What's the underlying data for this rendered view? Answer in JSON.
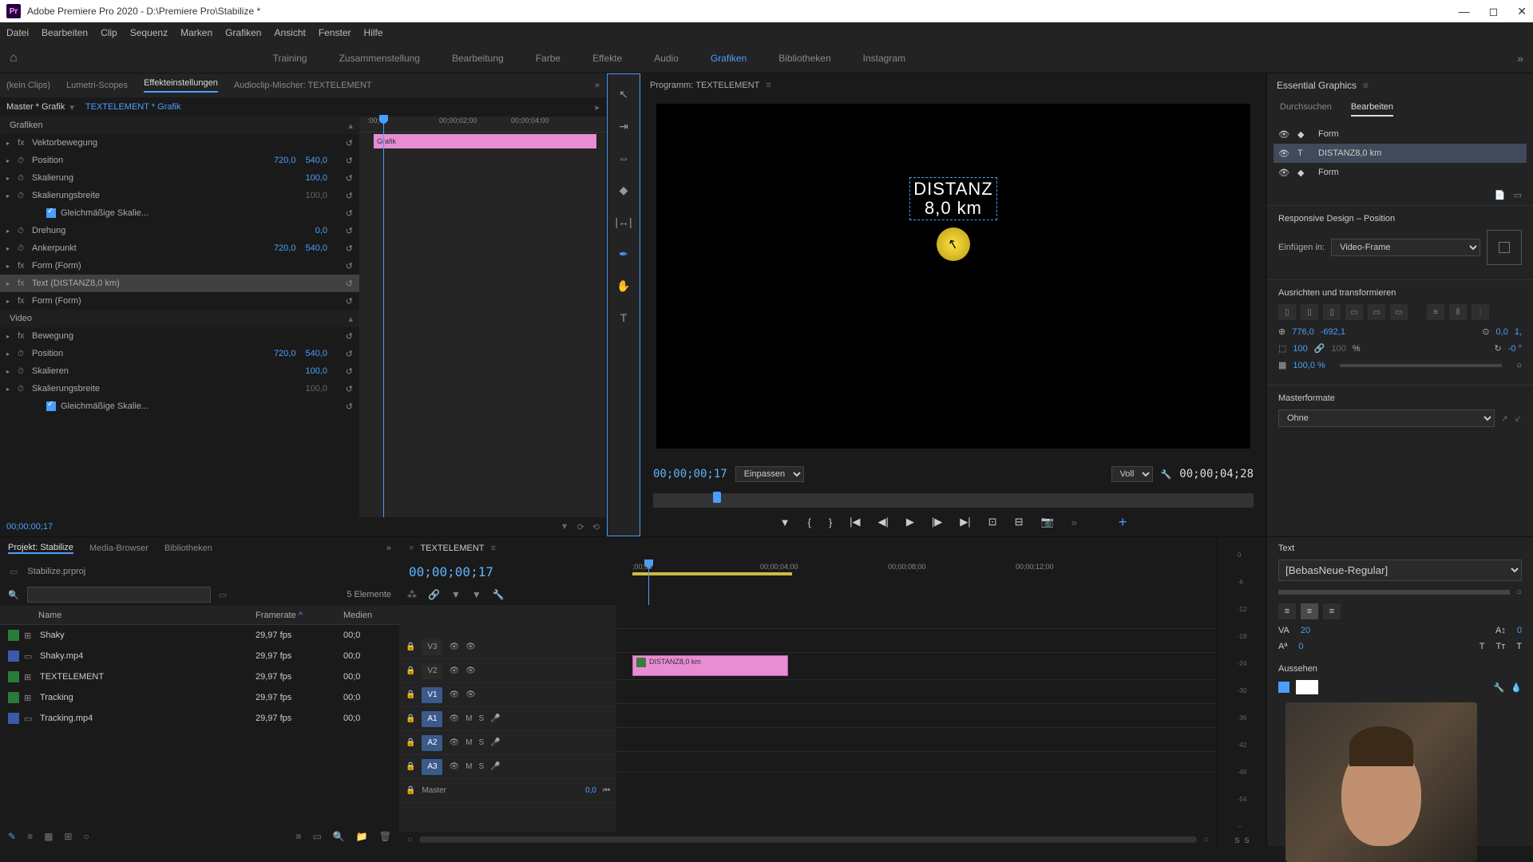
{
  "titlebar": {
    "app_badge": "Pr",
    "title": "Adobe Premiere Pro 2020 - D:\\Premiere Pro\\Stabilize *"
  },
  "menubar": [
    "Datei",
    "Bearbeiten",
    "Clip",
    "Sequenz",
    "Marken",
    "Grafiken",
    "Ansicht",
    "Fenster",
    "Hilfe"
  ],
  "workspaces": {
    "items": [
      "Training",
      "Zusammenstellung",
      "Bearbeitung",
      "Farbe",
      "Effekte",
      "Audio",
      "Grafiken",
      "Bibliotheken",
      "Instagram"
    ],
    "active": "Grafiken"
  },
  "effect_panel": {
    "tabs": [
      "(kein Clips)",
      "Lumetri-Scopes",
      "Effekteinstellungen",
      "Audioclip-Mischer: TEXTELEMENT"
    ],
    "active_tab": "Effekteinstellungen",
    "master": "Master * Grafik",
    "clip": "TEXTELEMENT * Grafik",
    "ruler": [
      ":00;00",
      "00;00;02;00",
      "00;00;04;00"
    ],
    "kf_clip_label": "Grafik",
    "groups": [
      {
        "label": "Grafiken",
        "type": "header"
      },
      {
        "label": "Vektorbewegung",
        "type": "fx"
      },
      {
        "label": "Position",
        "type": "prop",
        "val1": "720,0",
        "val2": "540,0"
      },
      {
        "label": "Skalierung",
        "type": "prop",
        "val1": "100,0"
      },
      {
        "label": "Skalierungsbreite",
        "type": "prop_gray",
        "val1": "100,0"
      },
      {
        "label": "Gleichmäßige Skalie...",
        "type": "check"
      },
      {
        "label": "Drehung",
        "type": "prop",
        "val1": "0,0"
      },
      {
        "label": "Ankerpunkt",
        "type": "prop",
        "val1": "720,0",
        "val2": "540,0"
      },
      {
        "label": "Form (Form)",
        "type": "fx"
      },
      {
        "label": "Text (DISTANZ8,0 km)",
        "type": "fx_sel"
      },
      {
        "label": "Form (Form)",
        "type": "fx"
      },
      {
        "label": "Video",
        "type": "header"
      },
      {
        "label": "Bewegung",
        "type": "fx"
      },
      {
        "label": "Position",
        "type": "prop",
        "val1": "720,0",
        "val2": "540,0"
      },
      {
        "label": "Skalieren",
        "type": "prop",
        "val1": "100,0"
      },
      {
        "label": "Skalierungsbreite",
        "type": "prop_gray",
        "val1": "100,0"
      },
      {
        "label": "Gleichmäßige Skalie...",
        "type": "check"
      }
    ],
    "footer_tc": "00;00;00;17"
  },
  "program": {
    "title": "Programm: TEXTELEMENT",
    "overlay_line1": "DISTANZ",
    "overlay_line2": "8,0 km",
    "tc_left": "00;00;00;17",
    "fit": "Einpassen",
    "quality": "Voll",
    "tc_right": "00;00;04;28"
  },
  "eg": {
    "title": "Essential Graphics",
    "tabs": [
      "Durchsuchen",
      "Bearbeiten"
    ],
    "active_tab": "Bearbeiten",
    "layers": [
      {
        "name": "Form",
        "type": "shape"
      },
      {
        "name": "DISTANZ8,0 km",
        "type": "text",
        "selected": true
      },
      {
        "name": "Form",
        "type": "shape"
      }
    ],
    "responsive_title": "Responsive Design – Position",
    "pin_label": "Einfügen in:",
    "pin_value": "Video-Frame",
    "align_title": "Ausrichten und transformieren",
    "pos_x": "776,0",
    "pos_y": "-692,1",
    "anchor_x": "0,0",
    "anchor_y": "1,",
    "scale": "100",
    "scale2": "100",
    "scale_unit": "%",
    "rotation": "-0 °",
    "opacity": "100,0 %",
    "master_title": "Masterformate",
    "master_value": "Ohne",
    "text_title": "Text",
    "font": "[BebasNeue-Regular]",
    "tracking": "20",
    "leading": "0",
    "baseline": "0",
    "appearance_title": "Aussehen"
  },
  "project": {
    "tabs": [
      "Projekt: Stabilize",
      "Media-Browser",
      "Bibliotheken"
    ],
    "active_tab": "Projekt: Stabilize",
    "filename": "Stabilize.prproj",
    "count": "5 Elemente",
    "cols": [
      "Name",
      "Framerate",
      "Medien"
    ],
    "items": [
      {
        "name": "Shaky",
        "color": "#2a7a3a",
        "fr": "29,97 fps",
        "med": "00;0",
        "icon": "seq"
      },
      {
        "name": "Shaky.mp4",
        "color": "#3a5aaa",
        "fr": "29,97 fps",
        "med": "00;0",
        "icon": "clip"
      },
      {
        "name": "TEXTELEMENT",
        "color": "#2a7a3a",
        "fr": "29,97 fps",
        "med": "00;0",
        "icon": "seq"
      },
      {
        "name": "Tracking",
        "color": "#2a7a3a",
        "fr": "29,97 fps",
        "med": "00;0",
        "icon": "seq"
      },
      {
        "name": "Tracking.mp4",
        "color": "#3a5aaa",
        "fr": "29,97 fps",
        "med": "00;0",
        "icon": "clip"
      }
    ]
  },
  "timeline": {
    "seq_name": "TEXTELEMENT",
    "tc": "00;00;00;17",
    "ruler": [
      ";00;00",
      "00;00;04;00",
      "00;00;08;00",
      "00;00;12;00"
    ],
    "tracks_v": [
      "V3",
      "V2",
      "V1"
    ],
    "tracks_a": [
      "A1",
      "A2",
      "A3"
    ],
    "master": "Master",
    "master_val": "0,0",
    "clip_label": "DISTANZ8,0 km"
  },
  "meter": {
    "marks": [
      "0",
      "-6",
      "-12",
      "-18",
      "-24",
      "-30",
      "-36",
      "-42",
      "-48",
      "-54",
      "--"
    ],
    "s1": "S",
    "s2": "S"
  }
}
